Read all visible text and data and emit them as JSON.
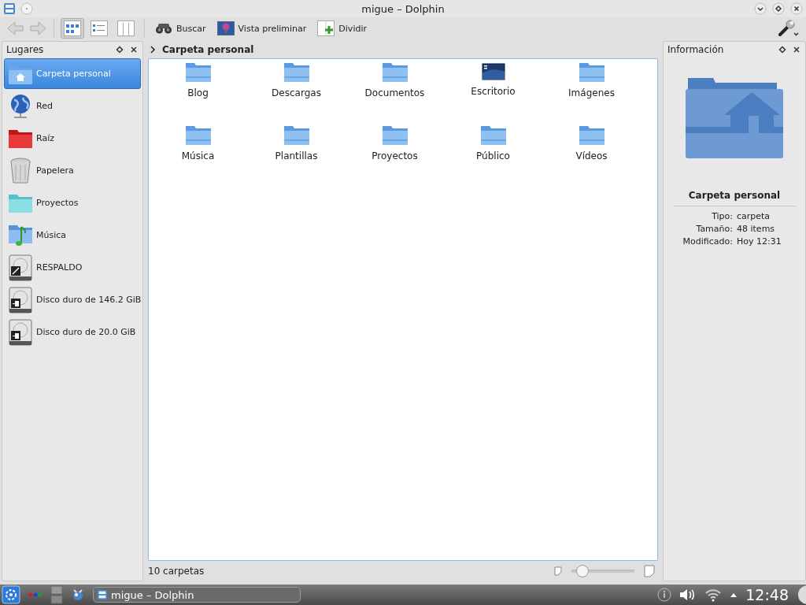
{
  "window": {
    "title": "migue – Dolphin"
  },
  "toolbar": {
    "view_modes": [
      {
        "kind": "icons",
        "selected": true
      },
      {
        "kind": "details",
        "selected": false
      },
      {
        "kind": "columns",
        "selected": false
      }
    ],
    "actions": [
      {
        "kind": "search",
        "label": "Buscar"
      },
      {
        "kind": "preview",
        "label": "Vista preliminar"
      },
      {
        "kind": "split",
        "label": "Dividir"
      }
    ]
  },
  "places": {
    "title": "Lugares",
    "items": [
      {
        "kind": "home",
        "label": "Carpeta personal",
        "selected": true
      },
      {
        "kind": "network",
        "label": "Red",
        "selected": false
      },
      {
        "kind": "root",
        "label": "Raíz",
        "selected": false
      },
      {
        "kind": "trash",
        "label": "Papelera",
        "selected": false
      },
      {
        "kind": "folder-cyan",
        "label": "Proyectos",
        "selected": false
      },
      {
        "kind": "music",
        "label": "Música",
        "selected": false
      },
      {
        "kind": "drive-edit",
        "label": "RESPALDO",
        "selected": false
      },
      {
        "kind": "drive",
        "label": "Disco duro de 146.2 GiB",
        "selected": false
      },
      {
        "kind": "drive",
        "label": "Disco duro de 20.0 GiB",
        "selected": false
      }
    ]
  },
  "breadcrumb": "Carpeta personal",
  "files": [
    {
      "kind": "folder",
      "name": "Blog"
    },
    {
      "kind": "folder",
      "name": "Descargas"
    },
    {
      "kind": "folder",
      "name": "Documentos"
    },
    {
      "kind": "desktop",
      "name": "Escritorio"
    },
    {
      "kind": "folder",
      "name": "Imágenes"
    },
    {
      "kind": "folder",
      "name": "Música"
    },
    {
      "kind": "folder",
      "name": "Plantillas"
    },
    {
      "kind": "folder",
      "name": "Proyectos"
    },
    {
      "kind": "folder",
      "name": "Público"
    },
    {
      "kind": "folder",
      "name": "Vídeos"
    }
  ],
  "status_bar": {
    "text": "10 carpetas",
    "zoom": {
      "level": 0.08
    }
  },
  "info": {
    "title": "Información",
    "name": "Carpeta personal",
    "fields": [
      {
        "label": "Tipo:",
        "value": "carpeta"
      },
      {
        "label": "Tamaño:",
        "value": "48 items"
      },
      {
        "label": "Modificado:",
        "value": "Hoy 12:31"
      }
    ]
  },
  "taskbar": {
    "task": "migue – Dolphin",
    "clock": "12:48"
  }
}
